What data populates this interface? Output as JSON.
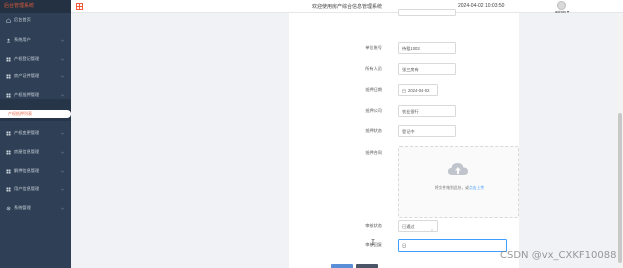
{
  "app": {
    "brand": "后台管理系统"
  },
  "header": {
    "title": "欢迎使用房产综合信息管理系统",
    "datetime": "2024-04-02 10:03:50",
    "user": "admin ▾",
    "logo_icon": "apps-grid-icon"
  },
  "sidebar": {
    "items": [
      {
        "label": "后台首页",
        "icon": "home-icon",
        "has_arrow": false
      },
      {
        "label": "系统用户",
        "icon": "user-icon",
        "has_arrow": true
      },
      {
        "label": "产权登记管理",
        "icon": "grid-icon",
        "has_arrow": true
      },
      {
        "label": "房产证件管理",
        "icon": "grid-icon",
        "has_arrow": true
      },
      {
        "label": "产权抵押管理",
        "icon": "grid-icon",
        "has_arrow": true,
        "expanded": true
      },
      {
        "label": "产权变更管理",
        "icon": "grid-icon",
        "has_arrow": true
      },
      {
        "label": "房屋信息管理",
        "icon": "grid-icon",
        "has_arrow": true
      },
      {
        "label": "解押信息管理",
        "icon": "grid-icon",
        "has_arrow": true
      },
      {
        "label": "用户信息管理",
        "icon": "grid-icon",
        "has_arrow": true
      },
      {
        "label": "系统管理",
        "icon": "gear-icon",
        "has_arrow": true
      }
    ],
    "active_subitem": "产权抵押列表"
  },
  "form": {
    "fields": [
      {
        "label": "单位账号",
        "value": "待租1003"
      },
      {
        "label": "所有人员",
        "value": "张三房有"
      },
      {
        "label": "抵押日期",
        "value": "2024-04-02"
      },
      {
        "label": "抵押公司",
        "value": "农业银行"
      },
      {
        "label": "抵押状态",
        "value": "登记中"
      }
    ],
    "upload": {
      "label": "抵押合同",
      "hint_text": "将文件拖到此处，或",
      "hint_link": "点击上传"
    },
    "review_status": {
      "label": "审核状态",
      "value": "已通过"
    },
    "review_reply": {
      "label": "审核回复",
      "value": "日"
    }
  },
  "watermark": "CSDN @vx_CXKF10088"
}
